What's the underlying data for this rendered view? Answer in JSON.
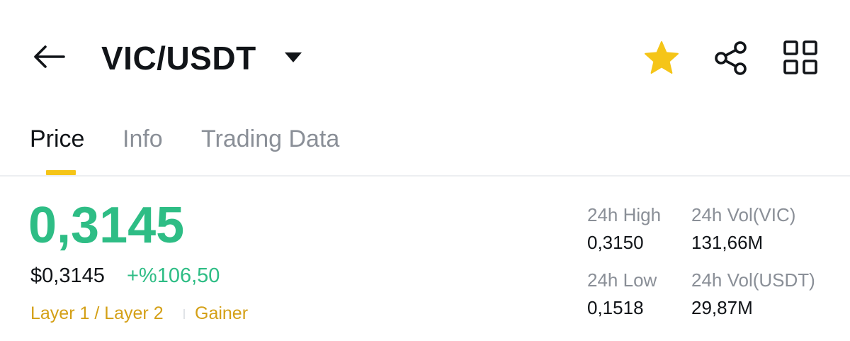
{
  "header": {
    "pair": "VIC/USDT",
    "icons": {
      "back": "back-arrow-icon",
      "caret": "caret-down-icon",
      "favorite": "star-icon",
      "share": "share-icon",
      "more": "grid-icon"
    },
    "favorite_color": "#f5c518"
  },
  "tabs": [
    {
      "label": "Price",
      "active": true
    },
    {
      "label": "Info",
      "active": false
    },
    {
      "label": "Trading Data",
      "active": false
    }
  ],
  "price": {
    "last": "0,3145",
    "fiat": "$0,3145",
    "change": "+%106,50",
    "color_up": "#2ebd85"
  },
  "tags": {
    "category": "Layer 1 / Layer 2",
    "status": "Gainer",
    "color": "#d4a017"
  },
  "stats": {
    "high_label": "24h High",
    "high_value": "0,3150",
    "low_label": "24h Low",
    "low_value": "0,1518",
    "vol_base_label": "24h Vol(VIC)",
    "vol_base_value": "131,66M",
    "vol_quote_label": "24h Vol(USDT)",
    "vol_quote_value": "29,87M"
  }
}
